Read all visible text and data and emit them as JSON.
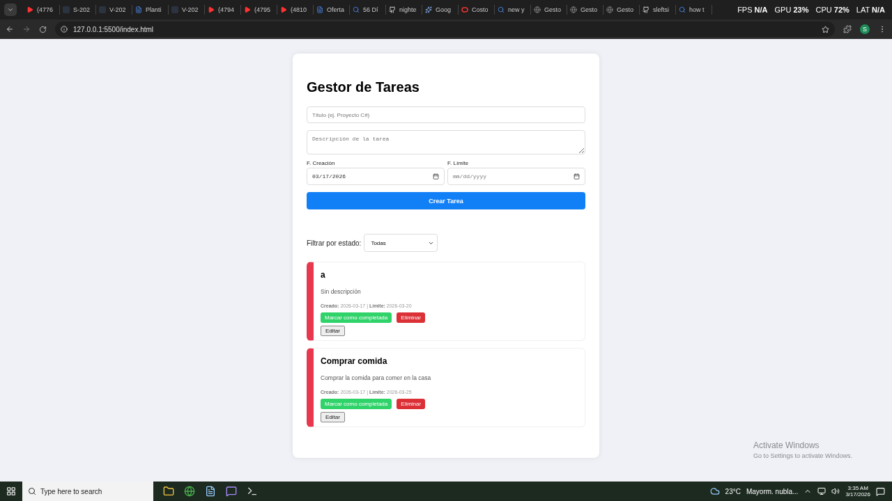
{
  "browser": {
    "tabs": [
      {
        "title": "(4776",
        "kind": "video"
      },
      {
        "title": "S-202",
        "kind": "page"
      },
      {
        "title": "V-202",
        "kind": "page"
      },
      {
        "title": "Planti",
        "kind": "doc"
      },
      {
        "title": "V-202",
        "kind": "page"
      },
      {
        "title": "(4794",
        "kind": "video"
      },
      {
        "title": "(4795",
        "kind": "video"
      },
      {
        "title": "(4810",
        "kind": "video"
      },
      {
        "title": "Oferta",
        "kind": "doc"
      },
      {
        "title": "56 Dí",
        "kind": "search"
      },
      {
        "title": "nighte",
        "kind": "code"
      },
      {
        "title": "Goog",
        "kind": "spark"
      },
      {
        "title": "Costo",
        "kind": "ring"
      },
      {
        "title": "new y",
        "kind": "search"
      },
      {
        "title": "Gesto",
        "kind": "globe"
      },
      {
        "title": "Gesto",
        "kind": "globe"
      },
      {
        "title": "Gesto",
        "kind": "globe"
      },
      {
        "title": "sleftsi",
        "kind": "code"
      },
      {
        "title": "how t",
        "kind": "search"
      }
    ],
    "url": "127.0.0.1:5500/index.html",
    "profile": "S"
  },
  "overlay": [
    {
      "label": "FPS",
      "value": "N/A"
    },
    {
      "label": "GPU",
      "value": "23%"
    },
    {
      "label": "CPU",
      "value": "72%"
    },
    {
      "label": "LAT",
      "value": "N/A"
    }
  ],
  "app": {
    "title": "Gestor de Tareas",
    "title_field": {
      "placeholder": "Título (ej. Proyecto C#)"
    },
    "description_field": {
      "placeholder": "Descripción de la tarea"
    },
    "created_field": {
      "label": "F. Creación",
      "value": "03/17/2026"
    },
    "deadline_field": {
      "label": "F. Límite",
      "placeholder": "mm/dd/yyyy"
    },
    "create_button": "Crear Tarea",
    "filter": {
      "label": "Filtrar por estado:",
      "value": "Todas"
    },
    "tasks": [
      {
        "title": "a",
        "description": "Sin descripción",
        "meta": "**Creado:** 2026-03-17 | **Límite:** 2026-03-20",
        "actions": [
          "Marcar como completada",
          "Eliminar",
          "Editar"
        ]
      },
      {
        "title": "Comprar comida",
        "description": "Comprar la comida para comer en la casa",
        "meta": "**Creado:** 2026-03-17 | **Límite:** 2026-03-25",
        "actions": [
          "Marcar como completada",
          "Eliminar",
          "Editar"
        ]
      }
    ]
  },
  "watermark": {
    "title": "Activate Windows",
    "subtitle": "Go to Settings to activate Windows."
  },
  "taskbar": {
    "search_placeholder": "Type here to search",
    "weather": "23°C",
    "forecast": "Mayorm. nubla...",
    "time": "3:35 AM",
    "date": "3/17/2026"
  }
}
